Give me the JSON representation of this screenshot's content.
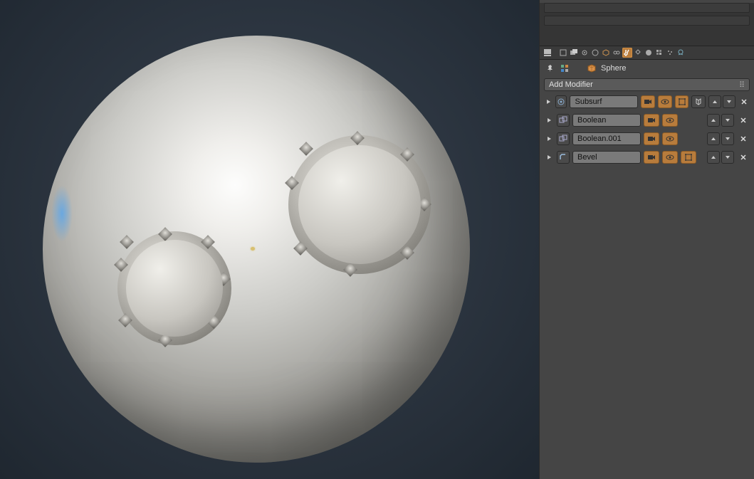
{
  "viewport": {
    "cursor_marker": true
  },
  "breadcrumb": {
    "object_name": "Sphere",
    "object_icon": "mesh-cube-icon"
  },
  "properties_tabs": {
    "active": "modifiers",
    "tabs": [
      "render",
      "render-layers",
      "scene",
      "world",
      "object",
      "constraints",
      "modifiers",
      "object-data",
      "material",
      "texture",
      "particles",
      "physics"
    ]
  },
  "add_modifier_label": "Add Modifier",
  "modifiers": [
    {
      "icon": "subsurf",
      "name": "Subsurf",
      "display_render": true,
      "display_realtime": true,
      "display_editmode": true,
      "display_cage": false,
      "extra_apply_visible": true
    },
    {
      "icon": "boolean",
      "name": "Boolean",
      "display_render": true,
      "display_realtime": true,
      "display_editmode": false,
      "display_cage": false,
      "extra_apply_visible": false
    },
    {
      "icon": "boolean",
      "name": "Boolean.001",
      "display_render": true,
      "display_realtime": true,
      "display_editmode": false,
      "display_cage": false,
      "extra_apply_visible": false
    },
    {
      "icon": "bevel",
      "name": "Bevel",
      "display_render": true,
      "display_realtime": true,
      "display_editmode": true,
      "display_cage": false,
      "extra_apply_visible": false
    }
  ]
}
